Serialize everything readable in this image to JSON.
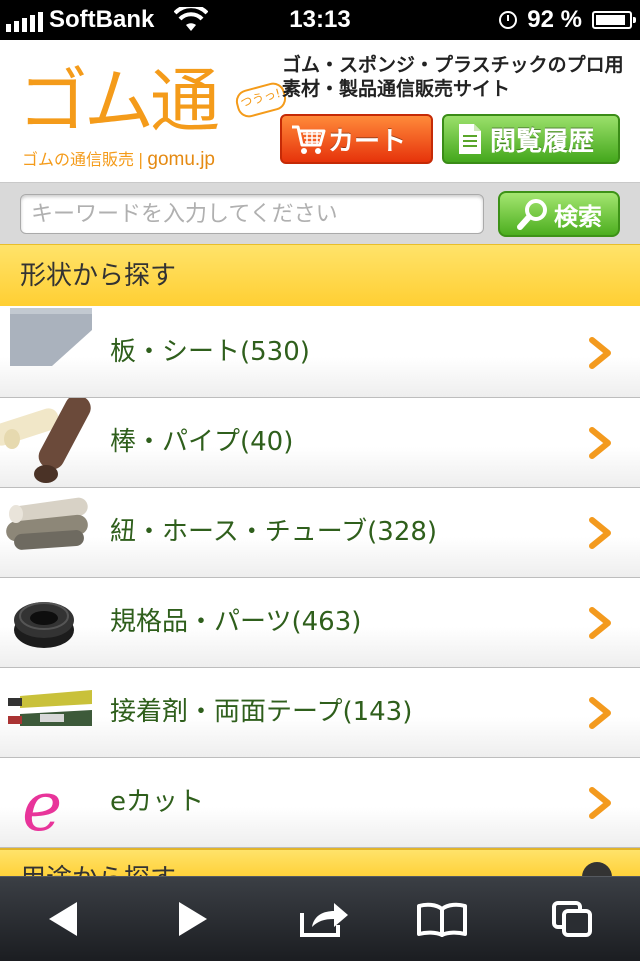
{
  "status_bar": {
    "carrier": "SoftBank",
    "time": "13:13",
    "battery": "92 %",
    "battery_level": 0.92
  },
  "header": {
    "logo_text": "ゴム通",
    "logo_badge": "つうっ!",
    "logo_sub": "ゴムの通信販売",
    "logo_domain": "gomu.jp",
    "tagline": "ゴム・スポンジ・プラスチックのプロ用素材・製品通信販売サイト",
    "cart_label": "カート",
    "history_label": "閲覧履歴"
  },
  "search": {
    "placeholder": "キーワードを入力してください",
    "value": "",
    "button_label": "検索"
  },
  "section": {
    "title": "形状から探す"
  },
  "categories": [
    {
      "label": "板・シート(530)",
      "icon": "sheet-thumbnail"
    },
    {
      "label": "棒・パイプ(40)",
      "icon": "rod-thumbnail"
    },
    {
      "label": "紐・ホース・チューブ(328)",
      "icon": "cord-thumbnail"
    },
    {
      "label": "規格品・パーツ(463)",
      "icon": "grommet-thumbnail"
    },
    {
      "label": "接着剤・両面テープ(143)",
      "icon": "adhesive-thumbnail"
    },
    {
      "label": "eカット",
      "icon": "e-cut-logo"
    }
  ],
  "next_section": {
    "title": "用途から探す"
  },
  "toolbar": {
    "items": [
      "back-icon",
      "forward-icon",
      "share-icon",
      "bookmarks-icon",
      "tabs-icon"
    ]
  },
  "colors": {
    "brand_orange": "#f49b1a",
    "cart_red": "#e6330b",
    "action_green": "#44a71c",
    "section_yellow": "#ffd84a",
    "link_green": "#2f5f1c",
    "chevron_orange": "#f39a1e"
  }
}
